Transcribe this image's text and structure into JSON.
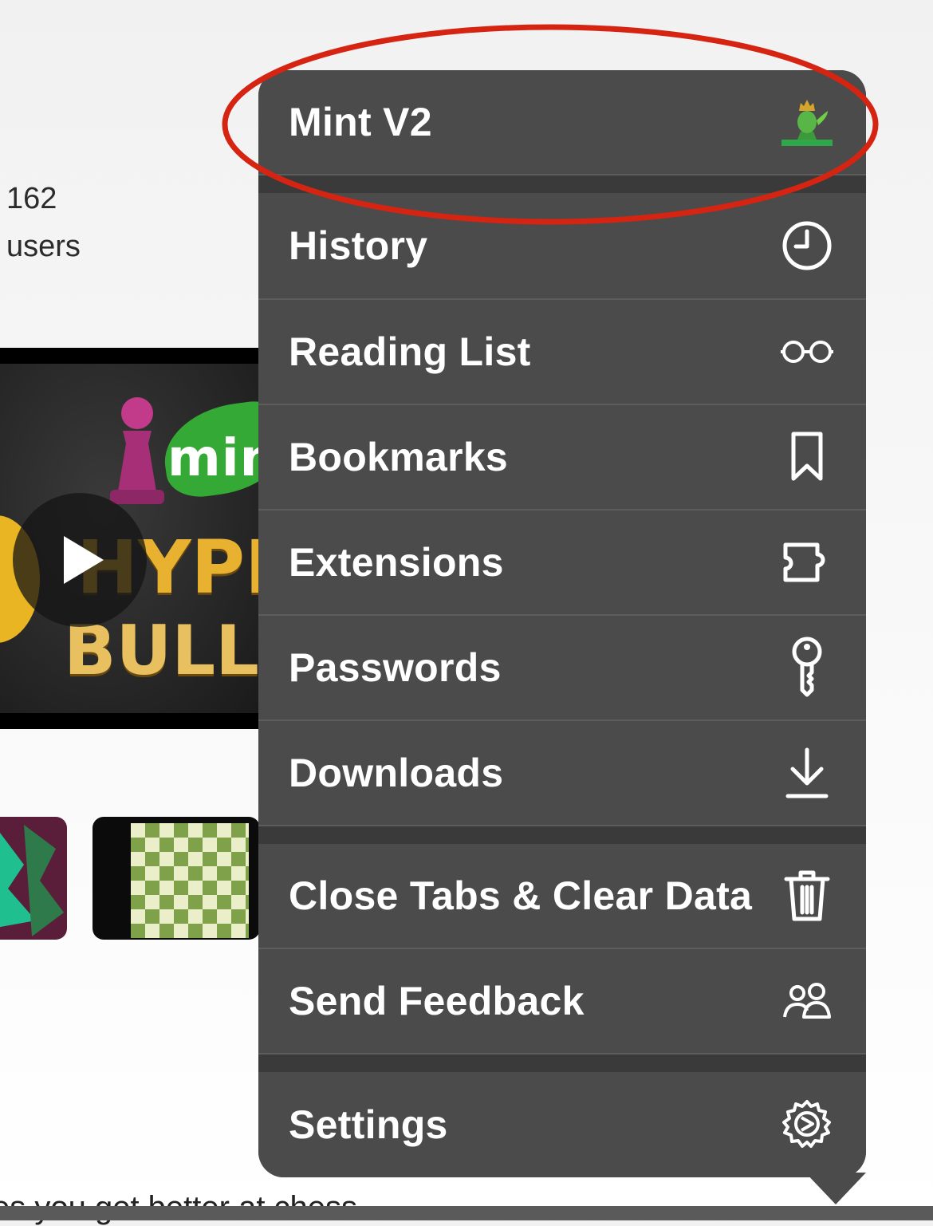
{
  "background": {
    "stat_number": "162",
    "stat_label": "users",
    "video_text_top": "min",
    "video_text_mid": "HYPE",
    "video_text_bottom": "BULL",
    "bottom_text": "es you get better at chess"
  },
  "menu": {
    "profile": {
      "label": "Mint V2",
      "icon": "mint-chess-king-icon"
    },
    "items": [
      {
        "label": "History",
        "icon": "clock-icon"
      },
      {
        "label": "Reading List",
        "icon": "glasses-icon"
      },
      {
        "label": "Bookmarks",
        "icon": "bookmark-icon"
      },
      {
        "label": "Extensions",
        "icon": "puzzle-icon"
      },
      {
        "label": "Passwords",
        "icon": "key-icon"
      },
      {
        "label": "Downloads",
        "icon": "download-icon"
      },
      {
        "label": "Close Tabs & Clear Data",
        "icon": "trash-icon"
      },
      {
        "label": "Send Feedback",
        "icon": "people-icon"
      },
      {
        "label": "Settings",
        "icon": "gear-icon"
      }
    ]
  },
  "colors": {
    "menu_bg": "#4b4b4b",
    "annotation": "#d62412"
  }
}
